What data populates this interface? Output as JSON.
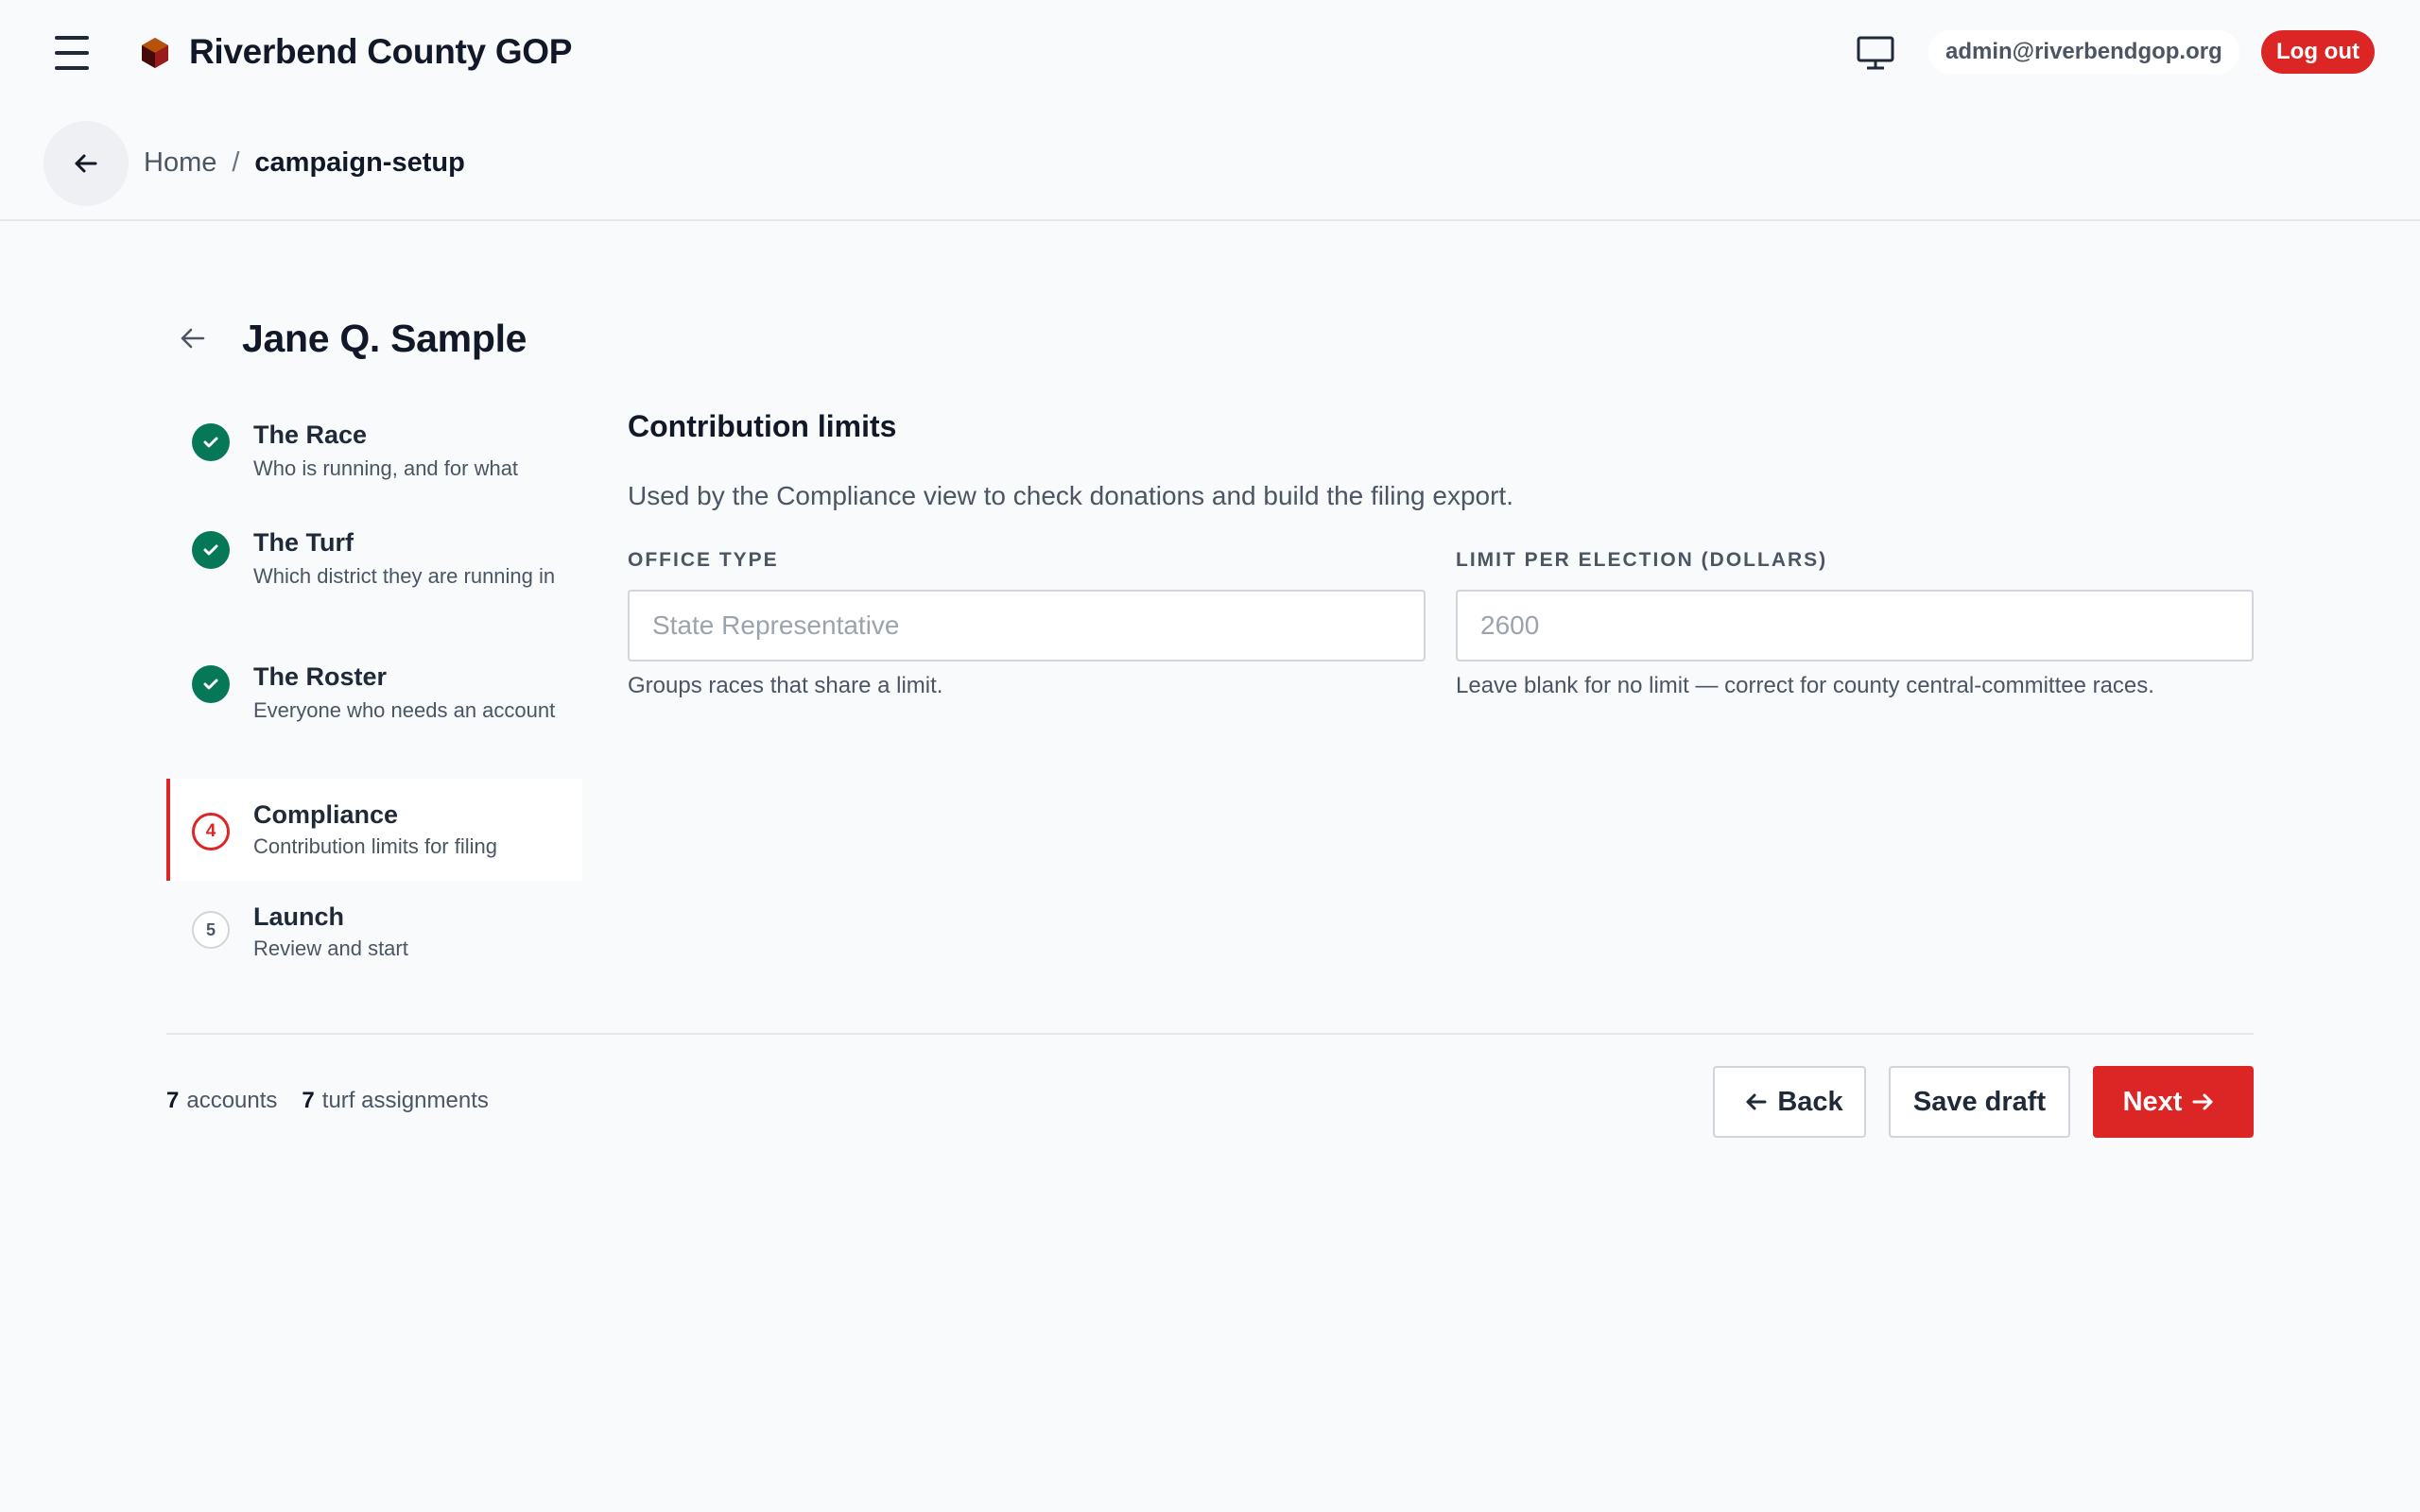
{
  "header": {
    "brand_name": "Riverbend County GOP",
    "user_email": "admin@riverbendgop.org",
    "logout_label": "Log out"
  },
  "breadcrumb": {
    "home": "Home",
    "separator": "/",
    "current": "campaign-setup"
  },
  "page": {
    "title": "Jane Q. Sample"
  },
  "steps": [
    {
      "title": "The Race",
      "subtitle": "Who is running, and for what",
      "status": "done"
    },
    {
      "title": "The Turf",
      "subtitle": "Which district they are running in",
      "status": "done"
    },
    {
      "title": "The Roster",
      "subtitle": "Everyone who needs an account",
      "status": "done"
    },
    {
      "number": "4",
      "title": "Compliance",
      "subtitle": "Contribution limits for filing",
      "status": "current"
    },
    {
      "number": "5",
      "title": "Launch",
      "subtitle": "Review and start",
      "status": "todo"
    }
  ],
  "form": {
    "section_title": "Contribution limits",
    "section_desc": "Used by the Compliance view to check donations and build the filing export.",
    "office_type": {
      "label": "Office type",
      "placeholder": "State Representative",
      "value": "",
      "hint": "Groups races that share a limit."
    },
    "limit": {
      "label": "Limit per election (dollars)",
      "placeholder": "2600",
      "value": "",
      "hint": "Leave blank for no limit — correct for county central-committee races."
    }
  },
  "footer": {
    "accounts_count": "7",
    "accounts_label": "accounts",
    "turf_count": "7",
    "turf_label": "turf assignments",
    "back_label": "Back",
    "save_label": "Save draft",
    "next_label": "Next"
  },
  "colors": {
    "accent": "#dc2626",
    "success": "#047857",
    "background": "#f8fafc"
  },
  "icons": {
    "menu": "hamburger-icon",
    "brand": "hexagon-logo-icon",
    "display": "monitor-icon",
    "back": "arrow-left-icon",
    "done": "check-icon",
    "next": "arrow-right-icon"
  }
}
